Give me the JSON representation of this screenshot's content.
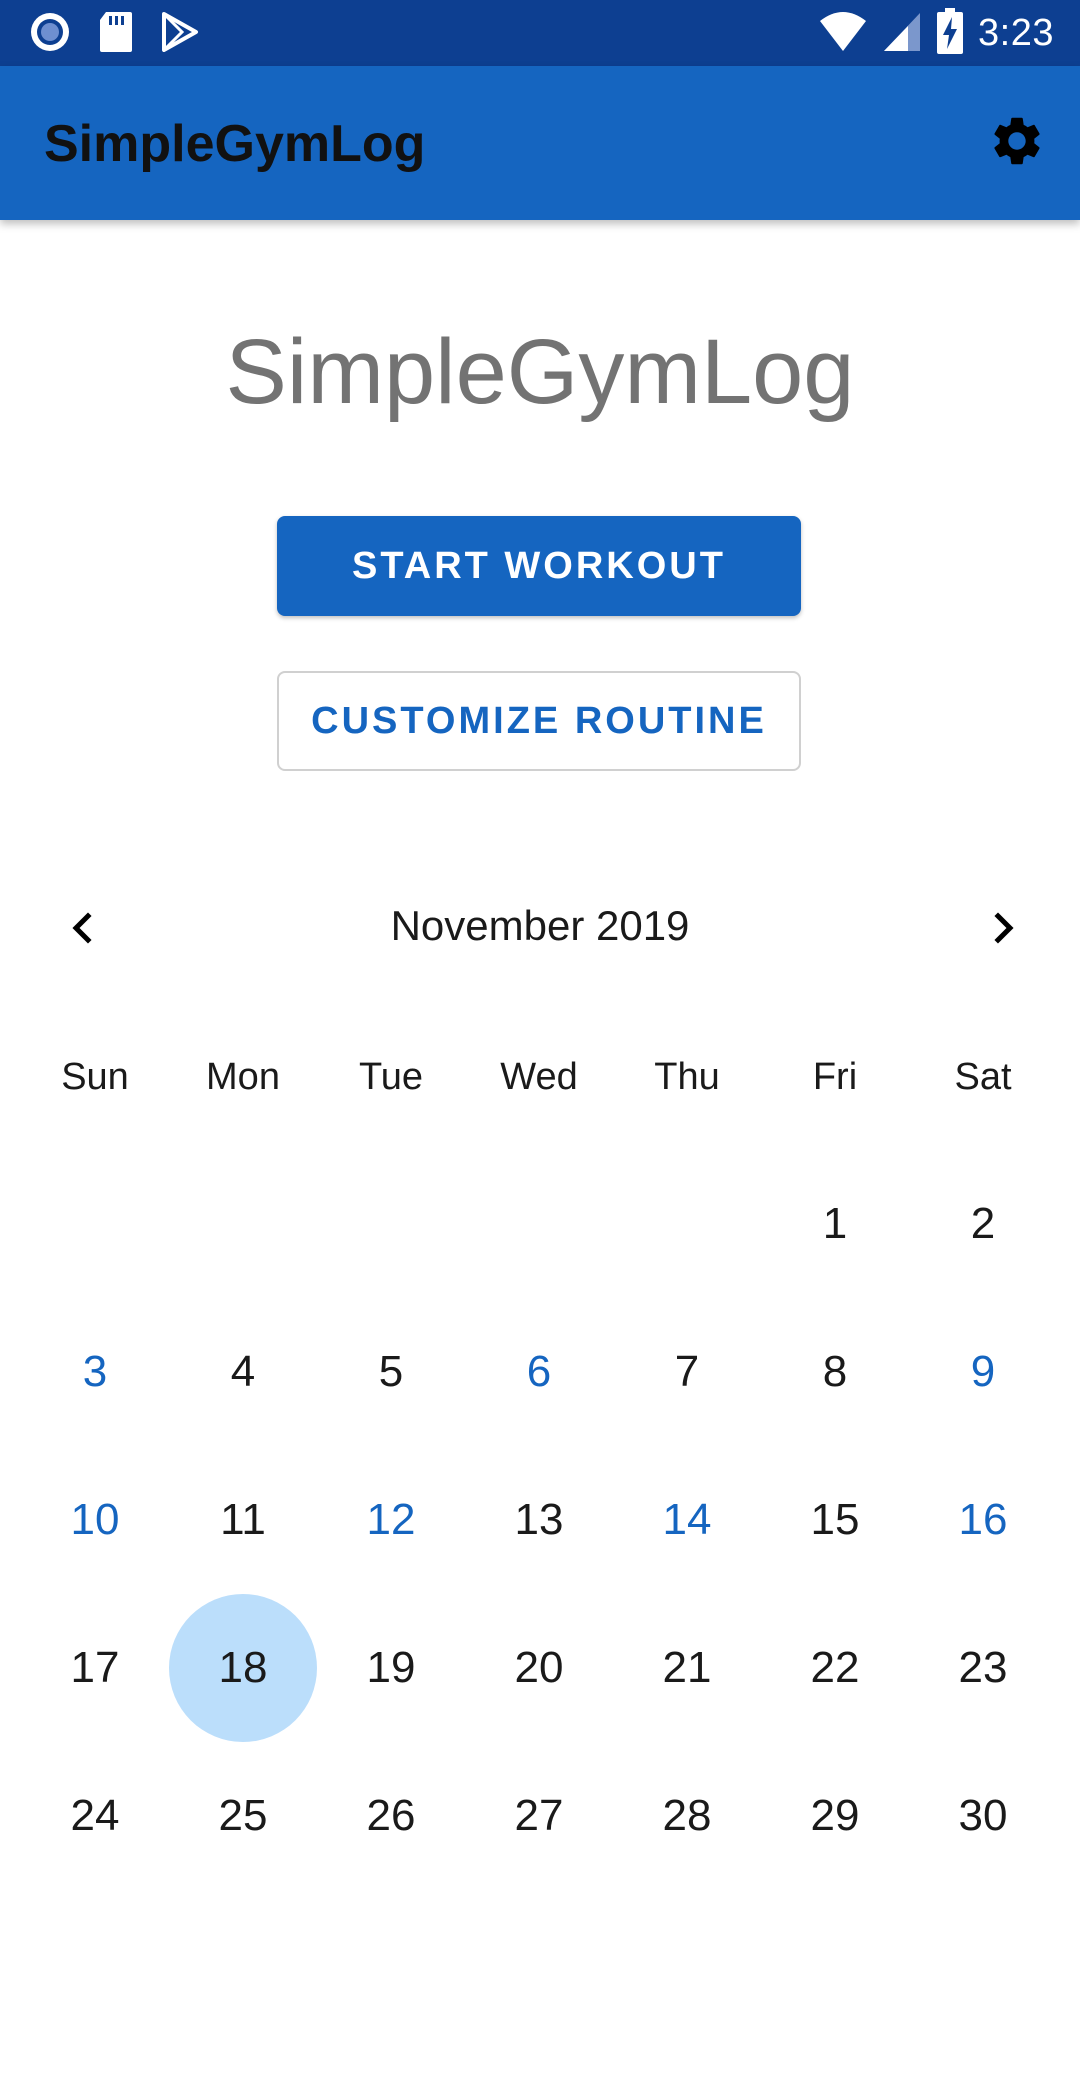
{
  "status_bar": {
    "time": "3:23",
    "left_icons": [
      "record-icon",
      "sd-card-icon",
      "play-store-icon"
    ],
    "right_icons": [
      "wifi-icon",
      "cell-signal-icon",
      "battery-charging-icon"
    ],
    "background": "#0D3F91"
  },
  "app_bar": {
    "title": "SimpleGymLog",
    "settings_icon": "gear-icon",
    "background": "#1565C0"
  },
  "main": {
    "title": "SimpleGymLog",
    "start_workout_label": "START WORKOUT",
    "customize_routine_label": "CUSTOMIZE ROUTINE"
  },
  "calendar": {
    "month_label": "November 2019",
    "prev_icon": "chevron-left-icon",
    "next_icon": "chevron-right-icon",
    "weekdays": [
      "Sun",
      "Mon",
      "Tue",
      "Wed",
      "Thu",
      "Fri",
      "Sat"
    ],
    "leading_blanks": 5,
    "days": [
      "1",
      "2",
      "3",
      "4",
      "5",
      "6",
      "7",
      "8",
      "9",
      "10",
      "11",
      "12",
      "13",
      "14",
      "15",
      "16",
      "17",
      "18",
      "19",
      "20",
      "21",
      "22",
      "23",
      "24",
      "25",
      "26",
      "27",
      "28",
      "29",
      "30"
    ],
    "workout_days": [
      "3",
      "6",
      "9",
      "10",
      "12",
      "14",
      "16"
    ],
    "selected_day": "18",
    "workout_color": "#1565C0",
    "selected_color": "#BBDEFB"
  }
}
